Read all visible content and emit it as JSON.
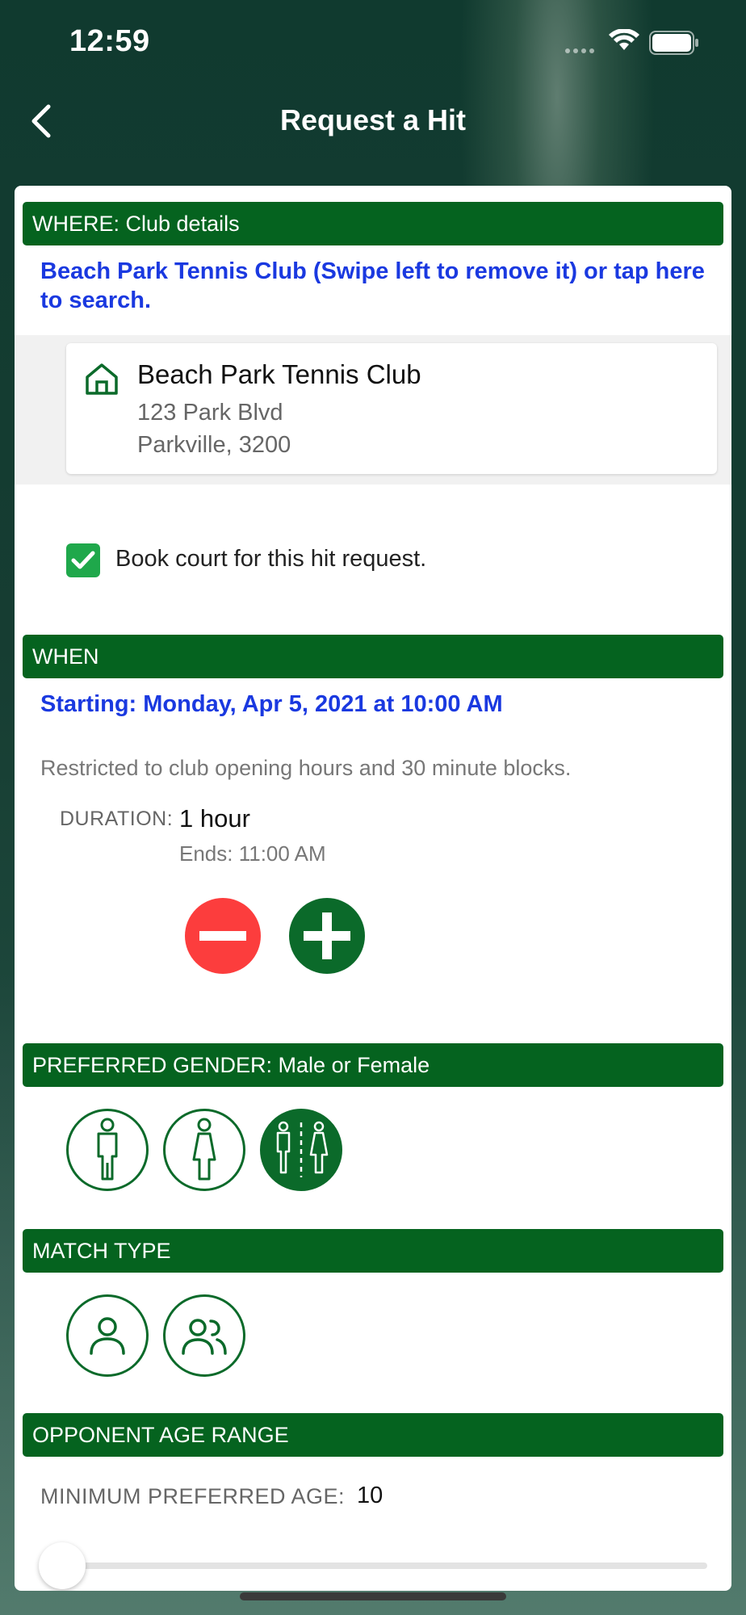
{
  "status_bar": {
    "time": "12:59"
  },
  "nav": {
    "title": "Request a Hit"
  },
  "where": {
    "header": "WHERE: Club details",
    "link": "Beach Park Tennis Club (Swipe left to remove it) or tap here to search.",
    "club": {
      "name": "Beach Park Tennis Club",
      "address_line1": "123 Park Blvd",
      "address_line2": "Parkville, 3200"
    },
    "book_court_label": "Book court for this hit request.",
    "book_court_checked": true
  },
  "when": {
    "header": "WHEN",
    "starting": "Starting: Monday, Apr 5, 2021 at 10:00 AM",
    "restriction": "Restricted to club opening hours and 30 minute blocks.",
    "duration_label": "DURATION:",
    "duration_value": "1 hour",
    "ends": "Ends: 11:00 AM"
  },
  "gender": {
    "header": "PREFERRED GENDER: Male or Female",
    "options": [
      "male",
      "female",
      "male-or-female"
    ],
    "selected": "male-or-female"
  },
  "match_type": {
    "header": "MATCH TYPE",
    "options": [
      "singles",
      "doubles"
    ]
  },
  "age": {
    "header": "OPPONENT AGE RANGE",
    "min_label": "MINIMUM PREFERRED AGE:",
    "min_value": "10"
  },
  "colors": {
    "brand_green": "#05631f",
    "link_blue": "#1a39e0",
    "minus_red": "#fc3d3d"
  }
}
